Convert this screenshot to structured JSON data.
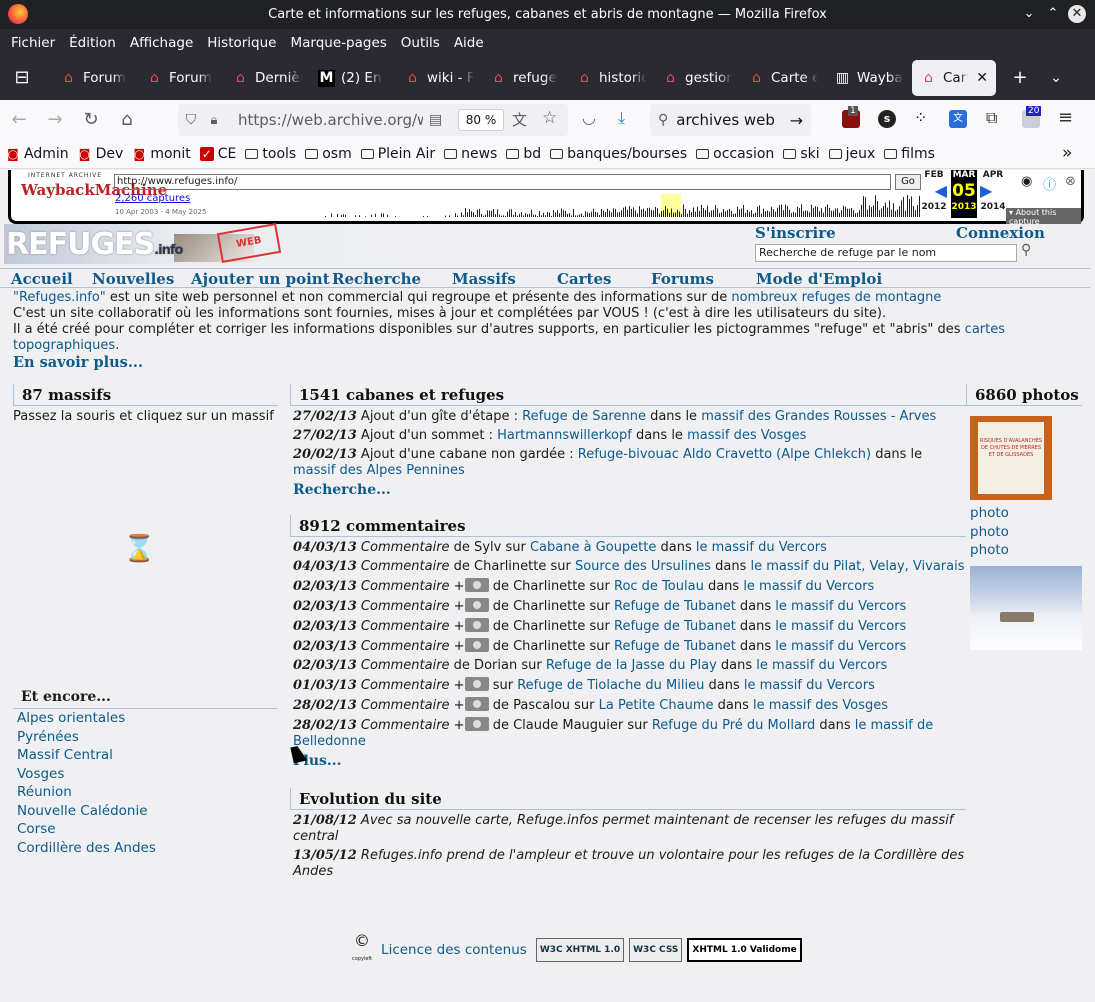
{
  "window": {
    "title": "Carte et informations sur les refuges, cabanes et abris de montagne — Mozilla Firefox"
  },
  "menu": [
    "Fichier",
    "Édition",
    "Affichage",
    "Historique",
    "Marque-pages",
    "Outils",
    "Aide"
  ],
  "tabs": [
    {
      "label": "Forum",
      "icon": "house-icon"
    },
    {
      "label": "Forum",
      "icon": "house-icon"
    },
    {
      "label": "Dernièr",
      "icon": "house-icon"
    },
    {
      "label": "(2) En",
      "icon": "m-icon"
    },
    {
      "label": "wiki - F",
      "icon": "house-icon"
    },
    {
      "label": "refuge",
      "icon": "house-icon"
    },
    {
      "label": "historic",
      "icon": "house-icon"
    },
    {
      "label": "gestion",
      "icon": "house-icon"
    },
    {
      "label": "Carte e",
      "icon": "house-icon"
    },
    {
      "label": "Wayba",
      "icon": "archive-icon"
    },
    {
      "label": "Carte",
      "icon": "house-icon",
      "active": true
    }
  ],
  "nav": {
    "url": "https://web.archive.org/we",
    "zoom": "80 %",
    "search": "archives web",
    "ext_badge_1": "1",
    "ext_badge_2": "20"
  },
  "bookmarks": [
    "Admin",
    "Dev",
    "monit",
    "CE",
    "tools",
    "osm",
    "Plein Air",
    "news",
    "bd",
    "banques/bourses",
    "occasion",
    "ski",
    "jeux",
    "films"
  ],
  "wayback": {
    "ia": "INTERNET ARCHIVE",
    "logo": "WaybackMachine",
    "url": "http://www.refuges.info/",
    "go": "Go",
    "captures": "2,260 captures",
    "range": "10 Apr 2003 - 4 May 2025",
    "prev_month": "FEB",
    "month": "MAR",
    "next_month": "APR",
    "day": "05",
    "prev_year": "2012",
    "year": "2013",
    "next_year": "2014",
    "about": "About this capture"
  },
  "site": {
    "logo": "REFUGES",
    "logo_suffix": ".info",
    "stamp": "WEB",
    "signup": "S'inscrire",
    "login": "Connexion",
    "search_placeholder": "Recherche de refuge par le nom",
    "nav": [
      "Accueil",
      "Nouvelles",
      "Ajouter un point",
      "Recherche",
      "Massifs",
      "Cartes",
      "Forums",
      "Mode d'Emploi"
    ],
    "intro": {
      "l1a": "\"Refuges.info\"",
      "l1b": " est un site web personnel et non commercial qui regroupe et présente des informations sur de ",
      "l1c": "nombreux refuges de montagne",
      ".": ".",
      "l2": "C'est un site collaboratif où les informations sont fournies, mises à jour et complétées par VOUS ! (c'est à dire les utilisateurs du site).",
      "l3a": "Il a été créé pour compléter et corriger les informations disponibles sur d'autres supports, en particulier les pictogrammes \"refuge\" et \"abris\" des ",
      "l3b": "cartes topographiques",
      "more": "En savoir plus..."
    },
    "massifs": {
      "title": "87 massifs",
      "hint": "Passez la souris et cliquez sur un massif"
    },
    "encore": {
      "title": "Et encore...",
      "links": [
        "Alpes orientales",
        "Pyrénées",
        "Massif Central",
        "Vosges",
        "Réunion",
        "Nouvelle Calédonie",
        "Corse",
        "Cordillère des Andes"
      ]
    },
    "cabanes": {
      "title": "1541 cabanes et refuges",
      "more": "Recherche...",
      "items": [
        {
          "date": "27/02/13",
          "text": "Ajout d'un gîte d'étape : ",
          "name": "Refuge de Sarenne",
          "mid": " dans le ",
          "massif": "massif des Grandes Rousses - Arves"
        },
        {
          "date": "27/02/13",
          "text": "Ajout d'un sommet : ",
          "name": "Hartmannswillerkopf",
          "mid": " dans le ",
          "massif": "massif des Vosges"
        },
        {
          "date": "20/02/13",
          "text": "Ajout d'une cabane non gardée : ",
          "name": "Refuge-bivouac Aldo Cravetto (Alpe Chlekch)",
          "mid": " dans le ",
          "massif": "massif des Alpes Pennines"
        }
      ]
    },
    "comments": {
      "title": "8912 commentaires",
      "more": "Plus...",
      "word": "Commentaire",
      "items": [
        {
          "date": "04/03/13",
          "photo": false,
          "who": " de Sylv sur ",
          "place": "Cabane à Goupette",
          "massif": "le massif du Vercors"
        },
        {
          "date": "04/03/13",
          "photo": false,
          "who": " de Charlinette sur ",
          "place": "Source des Ursulines",
          "massif": "le massif du Pilat, Velay, Vivarais"
        },
        {
          "date": "02/03/13",
          "photo": true,
          "who": " de Charlinette sur ",
          "place": "Roc de Toulau",
          "massif": "le massif du Vercors"
        },
        {
          "date": "02/03/13",
          "photo": true,
          "who": " de Charlinette sur ",
          "place": "Refuge de Tubanet",
          "massif": "le massif du Vercors"
        },
        {
          "date": "02/03/13",
          "photo": true,
          "who": " de Charlinette sur ",
          "place": "Refuge de Tubanet",
          "massif": "le massif du Vercors"
        },
        {
          "date": "02/03/13",
          "photo": true,
          "who": " de Charlinette sur ",
          "place": "Refuge de Tubanet",
          "massif": "le massif du Vercors"
        },
        {
          "date": "02/03/13",
          "photo": false,
          "who": " de Dorian sur ",
          "place": "Refuge de la Jasse du Play",
          "massif": "le massif du Vercors"
        },
        {
          "date": "01/03/13",
          "photo": true,
          "who": " sur ",
          "place": "Refuge de Tiolache du Milieu",
          "massif": "le massif du Vercors"
        },
        {
          "date": "28/02/13",
          "photo": true,
          "who": " de Pascalou sur ",
          "place": "La Petite Chaume",
          "massif": "le massif des Vosges"
        },
        {
          "date": "28/02/13",
          "photo": true,
          "who": " de Claude Mauguier sur ",
          "place": "Refuge du Pré du Mollard",
          "massif": "le massif de Belledonne"
        }
      ]
    },
    "evolution": {
      "title": "Evolution du site",
      "items": [
        {
          "date": "21/08/12",
          "text": "Avec sa nouvelle carte, Refuge.infos permet maintenant de recenser les refuges du massif central"
        },
        {
          "date": "13/05/12",
          "text": "Refuges.info prend de l'ampleur et trouve un volontaire pour les refuges de la Cordillère des Andes"
        }
      ]
    },
    "photos": {
      "title": "6860 photos",
      "links": [
        "photo",
        "photo",
        "photo"
      ],
      "sign_text": "RISQUES D'AVALANCHES DE CHUTES DE PIERRES ET DE GLISSADES"
    },
    "footer": {
      "licence": "Licence des contenus",
      "copyleft": "copyleft",
      "b1": "W3C XHTML 1.0",
      "b2": "W3C CSS",
      "b3": "XHTML 1.0 Validome"
    }
  }
}
